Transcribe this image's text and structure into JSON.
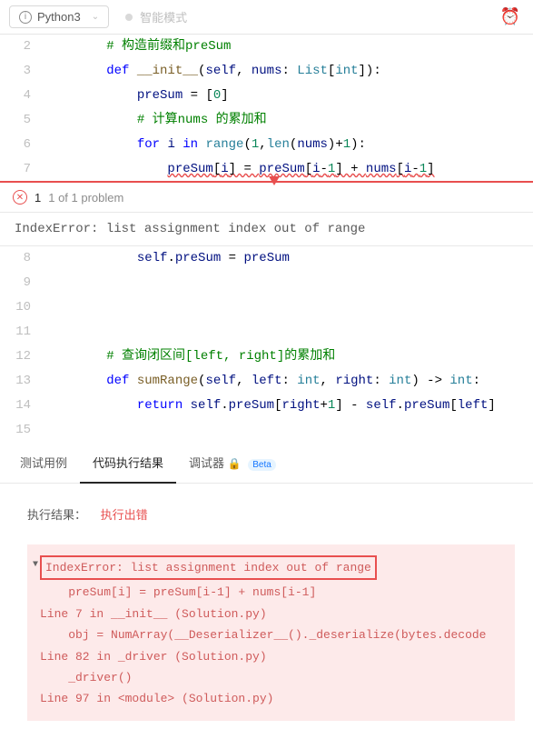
{
  "toolbar": {
    "language": "Python3",
    "smart_mode": "智能模式"
  },
  "code": {
    "lines": [
      {
        "n": 2,
        "tokens": [
          {
            "t": "        ",
            "c": ""
          },
          {
            "t": "# 构造前缀和preSum",
            "c": "cmt"
          }
        ]
      },
      {
        "n": 3,
        "tokens": [
          {
            "t": "        ",
            "c": ""
          },
          {
            "t": "def ",
            "c": "kw"
          },
          {
            "t": "__init__",
            "c": "func"
          },
          {
            "t": "(",
            "c": ""
          },
          {
            "t": "self",
            "c": "var"
          },
          {
            "t": ", ",
            "c": ""
          },
          {
            "t": "nums",
            "c": "var"
          },
          {
            "t": ": ",
            "c": ""
          },
          {
            "t": "List",
            "c": "builtin"
          },
          {
            "t": "[",
            "c": ""
          },
          {
            "t": "int",
            "c": "builtin"
          },
          {
            "t": "]):",
            "c": ""
          }
        ]
      },
      {
        "n": 4,
        "tokens": [
          {
            "t": "            ",
            "c": ""
          },
          {
            "t": "preSum",
            "c": "var"
          },
          {
            "t": " = [",
            "c": ""
          },
          {
            "t": "0",
            "c": "num"
          },
          {
            "t": "]",
            "c": ""
          }
        ]
      },
      {
        "n": 5,
        "tokens": [
          {
            "t": "            ",
            "c": ""
          },
          {
            "t": "# 计算nums 的累加和",
            "c": "cmt"
          }
        ]
      },
      {
        "n": 6,
        "tokens": [
          {
            "t": "            ",
            "c": ""
          },
          {
            "t": "for ",
            "c": "kw"
          },
          {
            "t": "i",
            "c": "var"
          },
          {
            "t": " in ",
            "c": "kw"
          },
          {
            "t": "range",
            "c": "builtin"
          },
          {
            "t": "(",
            "c": ""
          },
          {
            "t": "1",
            "c": "num"
          },
          {
            "t": ",",
            "c": ""
          },
          {
            "t": "len",
            "c": "builtin"
          },
          {
            "t": "(",
            "c": ""
          },
          {
            "t": "nums",
            "c": "var"
          },
          {
            "t": ")+",
            "c": ""
          },
          {
            "t": "1",
            "c": "num"
          },
          {
            "t": "):",
            "c": ""
          }
        ]
      },
      {
        "n": 7,
        "err": true,
        "tokens": [
          {
            "t": "                ",
            "c": ""
          },
          {
            "t": "preSum",
            "c": "var"
          },
          {
            "t": "[",
            "c": ""
          },
          {
            "t": "i",
            "c": "var"
          },
          {
            "t": "] = ",
            "c": ""
          },
          {
            "t": "preSum",
            "c": "var"
          },
          {
            "t": "[",
            "c": ""
          },
          {
            "t": "i",
            "c": "var"
          },
          {
            "t": "-",
            "c": ""
          },
          {
            "t": "1",
            "c": "num"
          },
          {
            "t": "] + ",
            "c": ""
          },
          {
            "t": "nums",
            "c": "var"
          },
          {
            "t": "[",
            "c": ""
          },
          {
            "t": "i",
            "c": "var"
          },
          {
            "t": "-",
            "c": ""
          },
          {
            "t": "1",
            "c": "num"
          },
          {
            "t": "]",
            "c": ""
          }
        ]
      }
    ],
    "lines2": [
      {
        "n": 8,
        "tokens": [
          {
            "t": "            ",
            "c": ""
          },
          {
            "t": "self",
            "c": "var"
          },
          {
            "t": ".",
            "c": ""
          },
          {
            "t": "preSum",
            "c": "var"
          },
          {
            "t": " = ",
            "c": ""
          },
          {
            "t": "preSum",
            "c": "var"
          }
        ]
      },
      {
        "n": 9,
        "tokens": []
      },
      {
        "n": 10,
        "tokens": []
      },
      {
        "n": 11,
        "tokens": []
      },
      {
        "n": 12,
        "tokens": [
          {
            "t": "        ",
            "c": ""
          },
          {
            "t": "# 查询闭区间[left, right]的累加和",
            "c": "cmt"
          }
        ]
      },
      {
        "n": 13,
        "tokens": [
          {
            "t": "        ",
            "c": ""
          },
          {
            "t": "def ",
            "c": "kw"
          },
          {
            "t": "sumRange",
            "c": "func"
          },
          {
            "t": "(",
            "c": ""
          },
          {
            "t": "self",
            "c": "var"
          },
          {
            "t": ", ",
            "c": ""
          },
          {
            "t": "left",
            "c": "var"
          },
          {
            "t": ": ",
            "c": ""
          },
          {
            "t": "int",
            "c": "builtin"
          },
          {
            "t": ", ",
            "c": ""
          },
          {
            "t": "right",
            "c": "var"
          },
          {
            "t": ": ",
            "c": ""
          },
          {
            "t": "int",
            "c": "builtin"
          },
          {
            "t": ") -> ",
            "c": ""
          },
          {
            "t": "int",
            "c": "builtin"
          },
          {
            "t": ":",
            "c": ""
          }
        ]
      },
      {
        "n": 14,
        "tokens": [
          {
            "t": "            ",
            "c": ""
          },
          {
            "t": "return ",
            "c": "kw"
          },
          {
            "t": "self",
            "c": "var"
          },
          {
            "t": ".",
            "c": ""
          },
          {
            "t": "preSum",
            "c": "var"
          },
          {
            "t": "[",
            "c": ""
          },
          {
            "t": "right",
            "c": "var"
          },
          {
            "t": "+",
            "c": ""
          },
          {
            "t": "1",
            "c": "num"
          },
          {
            "t": "] - ",
            "c": ""
          },
          {
            "t": "self",
            "c": "var"
          },
          {
            "t": ".",
            "c": ""
          },
          {
            "t": "preSum",
            "c": "var"
          },
          {
            "t": "[",
            "c": ""
          },
          {
            "t": "left",
            "c": "var"
          },
          {
            "t": "]",
            "c": ""
          }
        ]
      },
      {
        "n": 15,
        "tokens": []
      }
    ]
  },
  "problem": {
    "count": "1",
    "summary": "1 of 1 problem",
    "message": "IndexError: list assignment index out of range"
  },
  "tabs": {
    "testcase": "测试用例",
    "result": "代码执行结果",
    "debugger": "调试器",
    "beta": "Beta"
  },
  "result": {
    "label": "执行结果：",
    "status": "执行出错",
    "main_error": "IndexError: list assignment index out of range",
    "trace": [
      "    preSum[i] = preSum[i-1] + nums[i-1]",
      "Line 7 in __init__ (Solution.py)",
      "    obj = NumArray(__Deserializer__()._deserialize(bytes.decode",
      "Line 82 in _driver (Solution.py)",
      "    _driver()",
      "Line 97 in <module> (Solution.py)"
    ]
  }
}
